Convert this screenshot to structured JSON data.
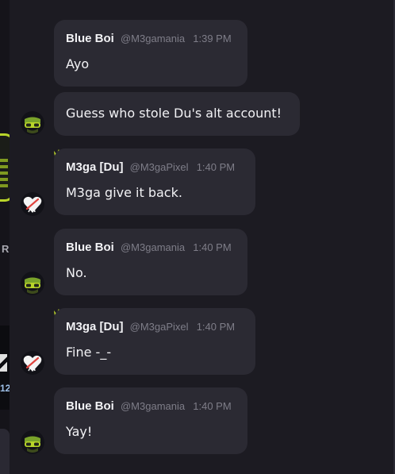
{
  "colors": {
    "background": "#1c1b22",
    "bubble": "#2b2a33",
    "text": "#f2f2f5",
    "muted": "#7e7d88",
    "crown": "#c5e02b"
  },
  "messages": [
    {
      "author": "Blue Boi",
      "handle": "@M3gamania",
      "time": "1:39 PM",
      "text": "Ayo",
      "avatar_icon": "goggles-avatar-icon"
    },
    {
      "text": "Guess who stole Du's alt account!"
    },
    {
      "author": "M3ga [Du]",
      "handle": "@M3gaPixel",
      "time": "1:40 PM",
      "text": "M3ga give it back.",
      "crown": "crown-icon",
      "avatar_icon": "heart-avatar-icon"
    },
    {
      "author": "Blue Boi",
      "handle": "@M3gamania",
      "time": "1:40 PM",
      "text": "No.",
      "avatar_icon": "goggles-avatar-icon"
    },
    {
      "author": "M3ga [Du]",
      "handle": "@M3gaPixel",
      "time": "1:40 PM",
      "text": "Fine -_-",
      "crown": "crown-icon",
      "avatar_icon": "heart-avatar-icon"
    },
    {
      "author": "Blue Boi",
      "handle": "@M3gamania",
      "time": "1:40 PM",
      "text": "Yay!",
      "avatar_icon": "goggles-avatar-icon"
    }
  ]
}
